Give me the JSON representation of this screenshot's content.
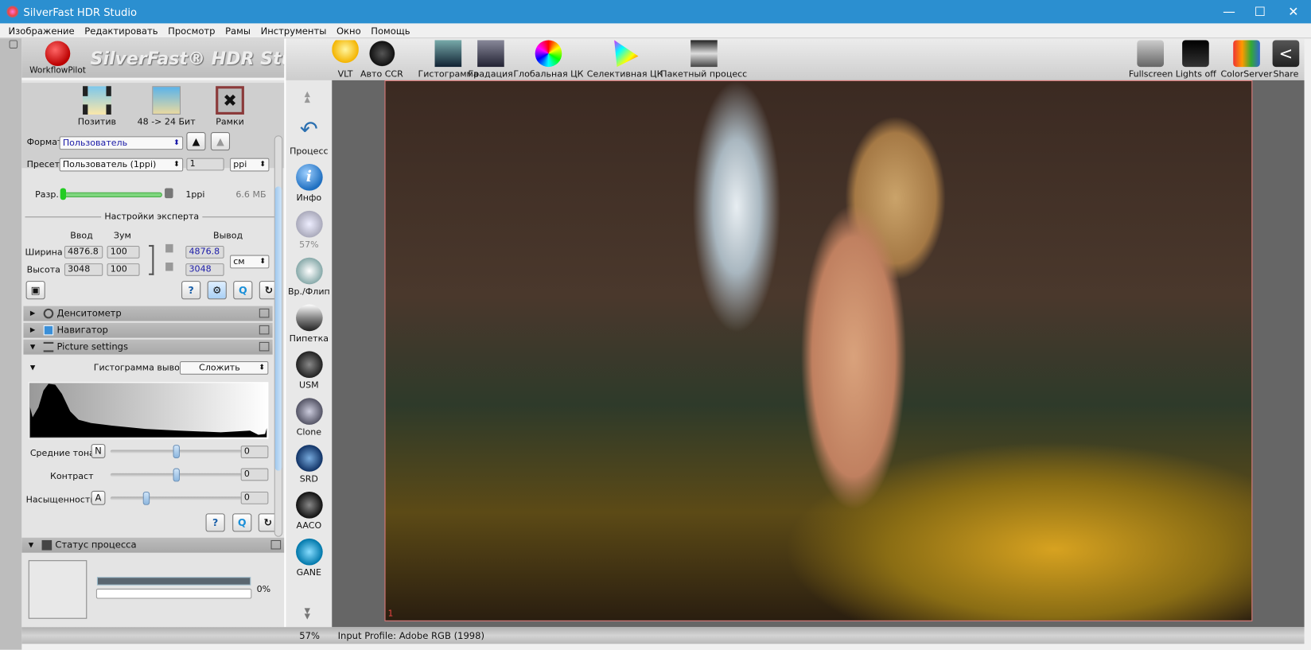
{
  "window": {
    "title": "SilverFast HDR Studio",
    "controls": [
      "minimize",
      "maximize",
      "close"
    ]
  },
  "menu": [
    "Изображение",
    "Редактировать",
    "Просмотр",
    "Рамы",
    "Инструменты",
    "Окно",
    "Помощь"
  ],
  "logo": {
    "workflow_pilot": "WorkflowPilot",
    "brand": "SilverFast® HDR Studio"
  },
  "modes": [
    {
      "label": "Позитив",
      "icon": "film-icon"
    },
    {
      "label": "48 -> 24 Бит",
      "icon": "palm-image-icon"
    },
    {
      "label": "Рамки",
      "icon": "tools-icon"
    }
  ],
  "settings": {
    "format_label": "Формат",
    "format_value": "Пользователь",
    "preset_label": "Пресет",
    "preset_value": "Пользователь (1ppi)",
    "preset_number": "1",
    "preset_unit": "ppi",
    "res_label": "Разр.",
    "res_value": "1ppi",
    "file_size": "6.6 МБ",
    "res_level": 0,
    "expert_title": "Настройки эксперта",
    "col_input": "Ввод",
    "col_zoom": "Зум",
    "col_output": "Вывод",
    "width_label": "Ширина",
    "width_in": "4876.8",
    "width_zoom": "100",
    "width_out": "4876.8",
    "height_label": "Высота",
    "height_in": "3048",
    "height_zoom": "100",
    "height_out": "3048",
    "unit": "см"
  },
  "sections": {
    "densitometer": "Денситометр",
    "navigator": "Навигатор",
    "picture": "Picture settings",
    "status": "Статус процесса"
  },
  "picture": {
    "hist_label": "Гистограмма вывода",
    "hist_mode": "Сложить",
    "midtones_label": "Средние тона",
    "midtones_btn": "N",
    "midtones_value": "0",
    "midtones_pos": 0.5,
    "contrast_label": "Контраст",
    "contrast_value": "0",
    "contrast_pos": 0.5,
    "saturation_label": "Насыщенность",
    "saturation_btn": "A",
    "saturation_value": "0",
    "saturation_pos": 0.26
  },
  "process": {
    "percent": "0%",
    "progress": 0
  },
  "tools": [
    {
      "label": "Процесс",
      "icon": "process-arrow-icon"
    },
    {
      "label": "Инфо",
      "icon": "info-icon"
    },
    {
      "label": "57%",
      "icon": "zoom-icon"
    },
    {
      "label": "Вр./Флип",
      "icon": "compass-icon"
    },
    {
      "label": "Пипетка",
      "icon": "pipette-icon"
    },
    {
      "label": "USM",
      "icon": "usm-icon"
    },
    {
      "label": "Clone",
      "icon": "clone-stamp-icon"
    },
    {
      "label": "SRD",
      "icon": "srd-icon"
    },
    {
      "label": "AACO",
      "icon": "aaco-icon"
    },
    {
      "label": "GANE",
      "icon": "gane-icon"
    }
  ],
  "toolbar": [
    {
      "label": "VLT",
      "icon": "bulb-icon"
    },
    {
      "label": "Авто CCR",
      "icon": "auto-ccr-icon"
    },
    {
      "label": "Гистограмма",
      "icon": "histogram-icon"
    },
    {
      "label": "Градация",
      "icon": "gradation-icon"
    },
    {
      "label": "Глобальная ЦК",
      "icon": "color-wheel-icon"
    },
    {
      "label": "Селективная ЦК",
      "icon": "color-triangle-icon"
    },
    {
      "label": "Пакетный процесс",
      "icon": "batch-icon"
    }
  ],
  "toolbar_right": [
    {
      "label": "Fullscreen",
      "icon": "fullscreen-icon"
    },
    {
      "label": "Lights off",
      "icon": "lights-off-icon"
    },
    {
      "label": "ColorServer",
      "icon": "colorserver-icon"
    },
    {
      "label": "Share",
      "icon": "share-icon"
    }
  ],
  "frame_number": "1",
  "status": {
    "zoom": "57%",
    "profile": "Input Profile: Adobe RGB (1998)"
  },
  "colors": {
    "titlebar": "#2b8fd0",
    "frame": "#e07a7a",
    "viewer_bg": "#666666",
    "output_text": "#1a1aa8"
  }
}
